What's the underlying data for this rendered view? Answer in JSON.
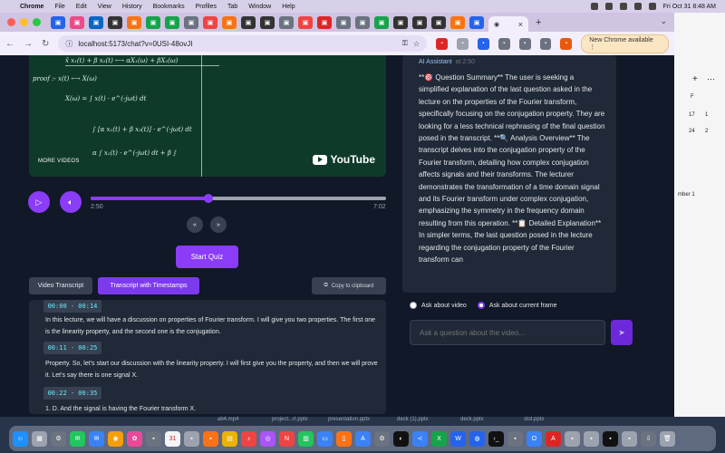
{
  "menubar": {
    "app": "Chrome",
    "items": [
      "File",
      "Edit",
      "View",
      "History",
      "Bookmarks",
      "Profiles",
      "Tab",
      "Window",
      "Help"
    ],
    "clock": "Fri Oct 31  8:48 AM"
  },
  "browser": {
    "url": "localhost:5173/chat?v=0USI-48ovJI",
    "new_chrome_label": "New Chrome available",
    "newtab_glyph": "+",
    "close_glyph": "×"
  },
  "video": {
    "more_videos": "MORE VIDEOS",
    "youtube": "YouTube",
    "board_lines": [
      "x̄ x₁(t) + β x₂(t)  ⟷  αX₁(ω) + βX₂(ω)",
      "proof :-     x(t) ⟷ X(ω)",
      "X(ω) = ∫ x(t) · e^(-jωt) dt",
      "∫ [α x₁(t) + β x₂(t)] · e^(-jωt) dt",
      "α ∫ x₁(t) · e^(-jωt) dt + β ∫"
    ]
  },
  "player": {
    "current_time": "2:50",
    "duration": "7:02",
    "progress_fraction": 0.4
  },
  "controls": {
    "start_quiz": "Start Quiz",
    "tab_video_transcript": "Video Transcript",
    "tab_timestamps": "Transcript with Timestamps",
    "copy_to_clipboard": "Copy to clipboard"
  },
  "transcript": [
    {
      "time": "00:00 - 00:14",
      "text": "In this lecture, we will have a discussion on properties of Fourier transform. I will give you two properties. The first one is the linearity property, and the second one is the conjugation."
    },
    {
      "time": "00:11 - 00:25",
      "text": "Property. So, let's start our discussion with the linearity property. I will first give you the property, and then we will prove it. Let's say there is one signal X."
    },
    {
      "time": "00:22 - 00:35",
      "text": "1. D. And the signal is having the Fourier transform X."
    }
  ],
  "chat": {
    "sender": "AI Assistant",
    "stamp": "at 2:50",
    "message": "**🎯 Question Summary** The user is seeking a simplified explanation of the last question asked in the lecture on the properties of the Fourier transform, specifically focusing on the conjugation property. They are looking for a less technical rephrasing of the final question posed in the transcript. **🔍 Analysis Overview** The transcript delves into the conjugation property of the Fourier transform, detailing how complex conjugation affects signals and their transforms. The lecturer demonstrates the transformation of a time domain signal and its Fourier transform under complex conjugation, emphasizing the symmetry in the frequency domain resulting from this operation. **📋 Detailed Explanation** In simpler terms, the last question posed in the lecture regarding the conjugation property of the Fourier transform can",
    "radio_video": "Ask about video",
    "radio_frame": "Ask about current frame",
    "input_placeholder": "Ask a question about the video..."
  },
  "desktop": {
    "right_labels": [
      "F",
      "17",
      "1",
      "24",
      "2",
      "mber 1"
    ],
    "dock_labels": [
      "ab4.mp4",
      "project...rt.pptx",
      "presentation.pptx",
      "deck (1).pptx",
      "deck.pptx",
      "slot.pptx"
    ]
  },
  "colors": {
    "accent": "#8b3cf7",
    "panel": "#1f2937",
    "background": "#111827",
    "timestamp": "#67e8f9"
  }
}
